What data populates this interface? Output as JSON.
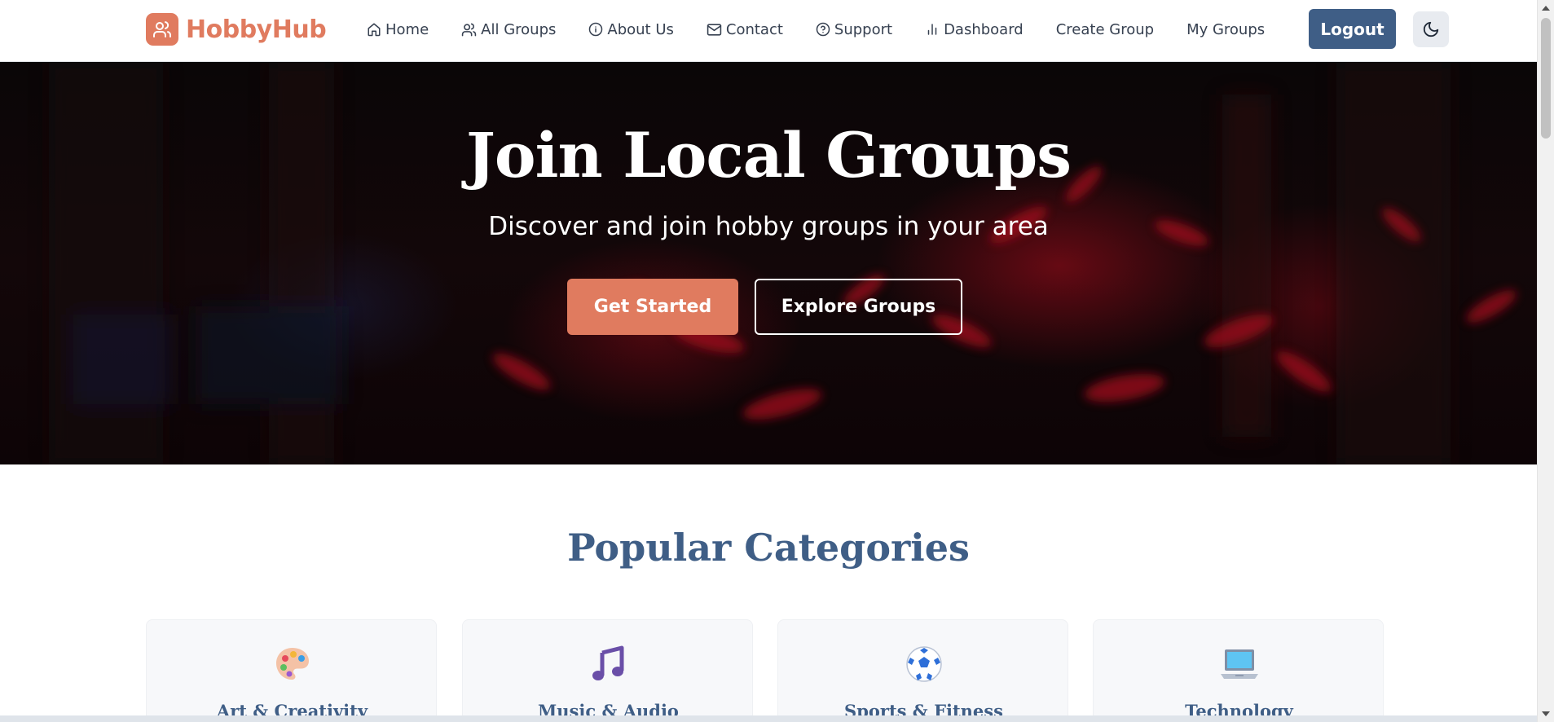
{
  "app": {
    "name": "HobbyHub"
  },
  "nav": {
    "links": [
      {
        "label": "Home",
        "icon": "home-icon"
      },
      {
        "label": "All Groups",
        "icon": "users-icon"
      },
      {
        "label": "About Us",
        "icon": "info-icon"
      },
      {
        "label": "Contact",
        "icon": "mail-icon"
      },
      {
        "label": "Support",
        "icon": "help-circle-icon"
      },
      {
        "label": "Dashboard",
        "icon": "bar-chart-icon"
      },
      {
        "label": "Create Group"
      },
      {
        "label": "My Groups"
      }
    ],
    "logout_label": "Logout",
    "theme_toggle_icon": "moon-icon"
  },
  "hero": {
    "title": "Join Local Groups",
    "subtitle": "Discover and join hobby groups in your area",
    "primary_cta": "Get Started",
    "secondary_cta": "Explore Groups"
  },
  "categories": {
    "title": "Popular Categories",
    "items": [
      {
        "label": "Art & Creativity",
        "icon": "palette-icon"
      },
      {
        "label": "Music & Audio",
        "icon": "music-note-icon"
      },
      {
        "label": "Sports & Fitness",
        "icon": "soccer-ball-icon"
      },
      {
        "label": "Technology",
        "icon": "laptop-icon"
      }
    ]
  },
  "colors": {
    "brand": "#e07b5f",
    "primary_dark": "#3f5e86",
    "text": "#374151"
  }
}
